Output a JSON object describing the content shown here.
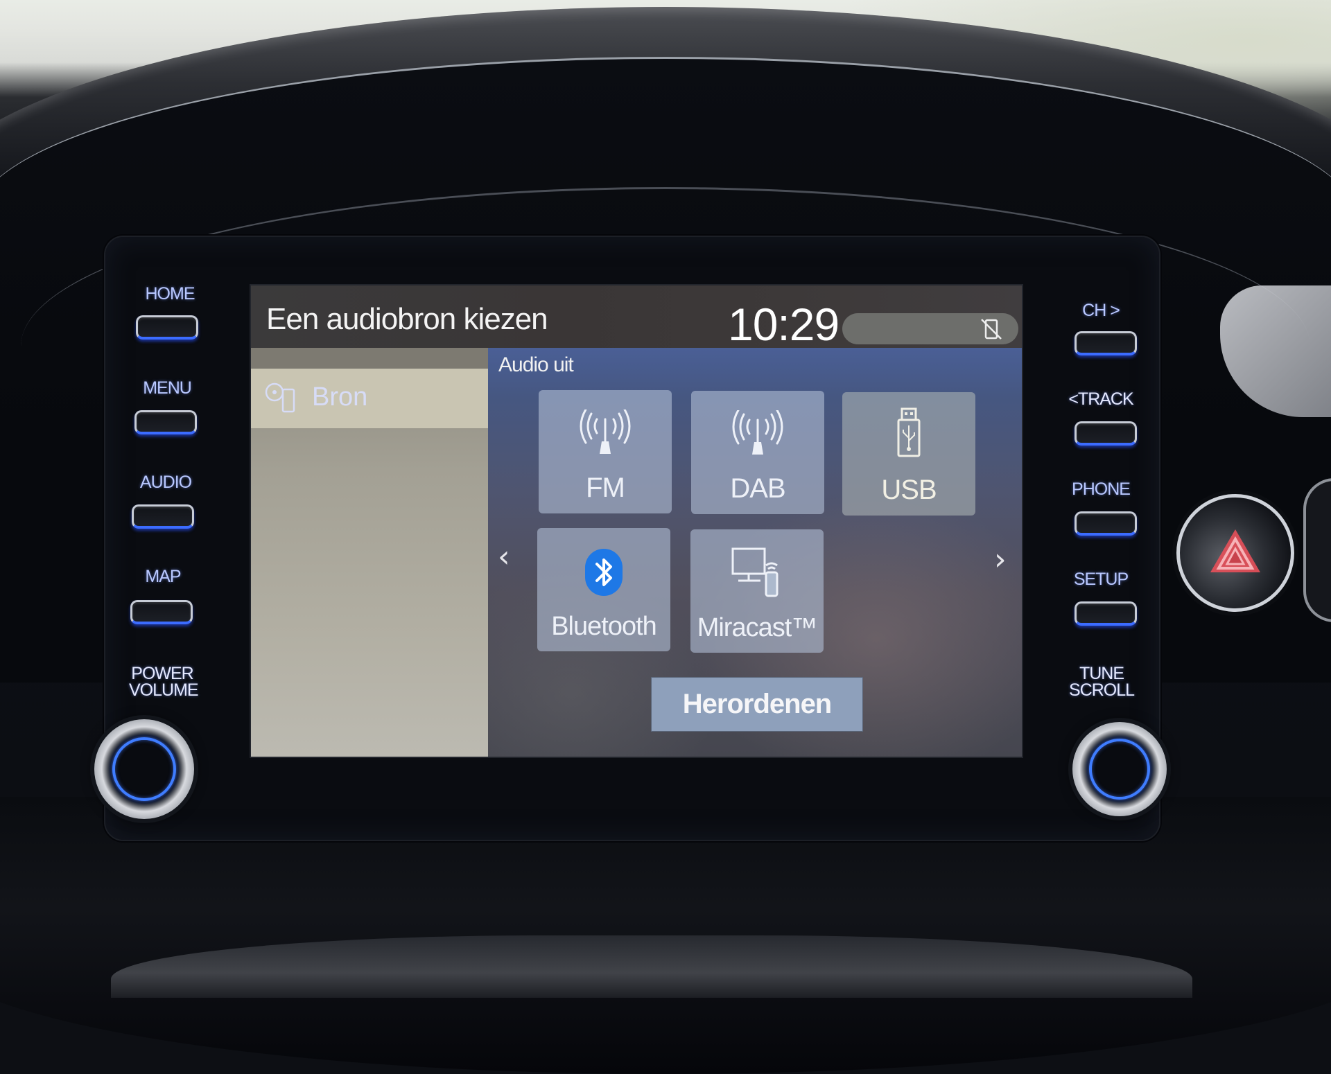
{
  "screen": {
    "header": {
      "title": "Een audiobron kiezen",
      "clock": "10:29",
      "status_icon": "phone-disconnected-icon"
    },
    "left_panel": {
      "items": [
        {
          "label": "Bron",
          "icon": "source-icon",
          "selected": true
        }
      ]
    },
    "main": {
      "section_label": "Audio uit",
      "tiles": [
        {
          "label": "FM",
          "icon": "radio-antenna-icon"
        },
        {
          "label": "DAB",
          "icon": "radio-antenna-icon"
        },
        {
          "label": "USB",
          "icon": "usb-icon"
        },
        {
          "label": "Bluetooth",
          "icon": "bluetooth-icon",
          "icon_color": "#1e78e6"
        },
        {
          "label": "Miracast™",
          "icon": "miracast-icon"
        }
      ],
      "prev_arrow": "‹",
      "next_arrow": "›",
      "reorder_label": "Herordenen"
    }
  },
  "hardware": {
    "left_buttons": [
      {
        "label": "HOME"
      },
      {
        "label": "MENU"
      },
      {
        "label": "AUDIO"
      },
      {
        "label": "MAP"
      }
    ],
    "left_knob_label_1": "POWER",
    "left_knob_label_2": "VOLUME",
    "right_buttons": [
      {
        "label": "CH >"
      },
      {
        "label": "<TRACK"
      },
      {
        "label": "PHONE"
      },
      {
        "label": "SETUP"
      }
    ],
    "right_knob_label_1": "TUNE",
    "right_knob_label_2": "SCROLL",
    "hazard": "hazard-warning-icon"
  },
  "colors": {
    "accent_blue": "#3f7dff",
    "bluetooth_blue": "#1e78e6",
    "hazard_red": "#e8505a"
  }
}
